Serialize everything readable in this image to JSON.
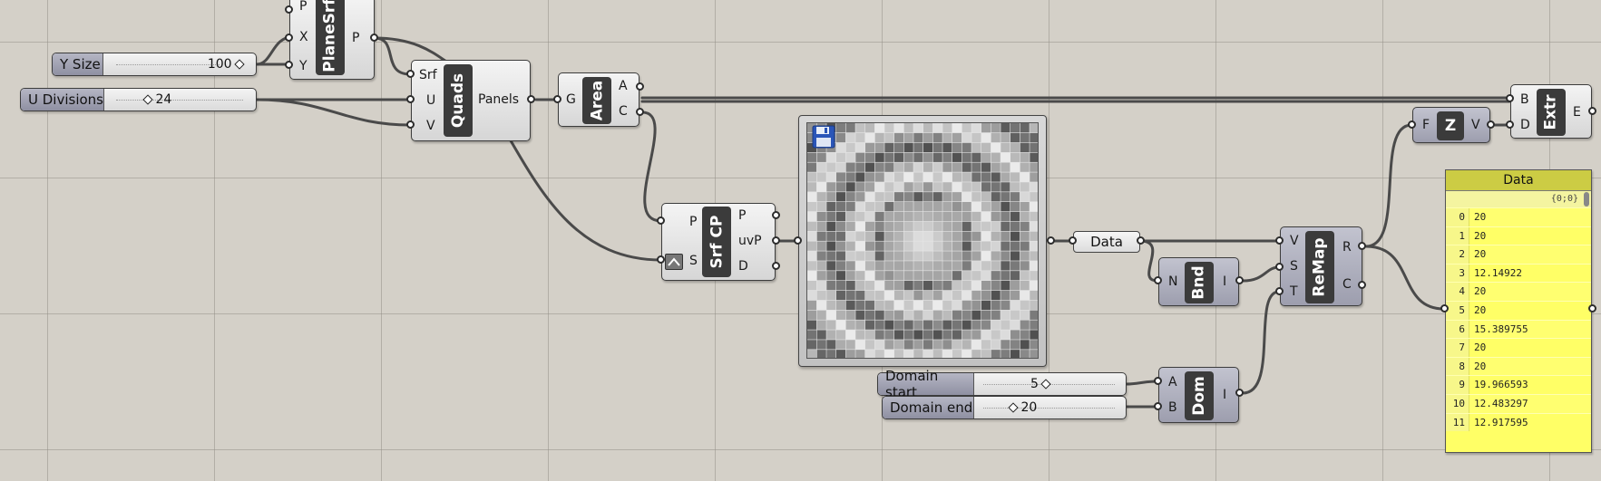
{
  "sliders": {
    "y_size": {
      "label": "Y Size",
      "value": "100"
    },
    "u_divisions": {
      "label": "U Divisions",
      "value": "24"
    },
    "domain_start": {
      "label": "Domain start",
      "value": "5"
    },
    "domain_end": {
      "label": "Domain end",
      "value": "20"
    }
  },
  "components": {
    "planesrf": {
      "name": "PlaneSrf",
      "inputs": [
        "P",
        "X",
        "Y"
      ],
      "outputs": [
        "P"
      ]
    },
    "quads": {
      "name": "Quads",
      "inputs": [
        "Srf",
        "U",
        "V"
      ],
      "outputs": [
        "Panels"
      ]
    },
    "area": {
      "name": "Area",
      "inputs": [
        "G"
      ],
      "outputs": [
        "A",
        "C"
      ]
    },
    "srfcp": {
      "name": "Srf CP",
      "inputs": [
        "P",
        "S"
      ],
      "outputs": [
        "P",
        "uvP",
        "D"
      ]
    },
    "bnd": {
      "name": "Bnd",
      "inputs": [
        "N"
      ],
      "outputs": [
        "I"
      ]
    },
    "dom": {
      "name": "Dom",
      "inputs": [
        "A",
        "B"
      ],
      "outputs": [
        "I"
      ]
    },
    "remap": {
      "name": "ReMap",
      "inputs": [
        "V",
        "S",
        "T"
      ],
      "outputs": [
        "R",
        "C"
      ]
    },
    "z": {
      "name": "Z",
      "inputs": [
        "F"
      ],
      "outputs": [
        "V"
      ]
    },
    "extr": {
      "name": "Extr",
      "inputs": [
        "B",
        "D"
      ],
      "outputs": [
        "E"
      ]
    }
  },
  "data_param": {
    "label": "Data"
  },
  "panel": {
    "title": "Data",
    "path": "{0;0}",
    "rows": [
      {
        "i": "0",
        "v": "20"
      },
      {
        "i": "1",
        "v": "20"
      },
      {
        "i": "2",
        "v": "20"
      },
      {
        "i": "3",
        "v": "12.14922"
      },
      {
        "i": "4",
        "v": "20"
      },
      {
        "i": "5",
        "v": "20"
      },
      {
        "i": "6",
        "v": "15.389755"
      },
      {
        "i": "7",
        "v": "20"
      },
      {
        "i": "8",
        "v": "20"
      },
      {
        "i": "9",
        "v": "19.966593"
      },
      {
        "i": "10",
        "v": "12.483297"
      },
      {
        "i": "11",
        "v": "12.917595"
      }
    ]
  },
  "icons": {
    "viewer": "save-disk-icon",
    "reparam": "reparameterize-icon"
  },
  "colors": {
    "canvas": "#d4d0c8",
    "panel": "#ffff66",
    "component_dark": "#3b3b3b"
  }
}
